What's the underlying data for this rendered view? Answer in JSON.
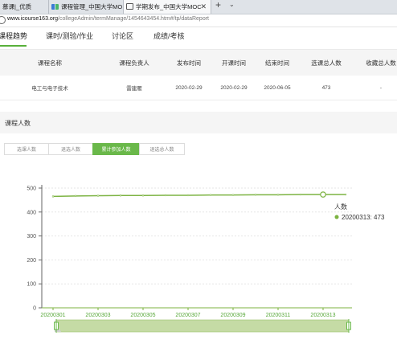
{
  "browser": {
    "tabs": [
      {
        "label": "慕课|_优质",
        "icon": "",
        "active": false
      },
      {
        "label": "课程管理_中国大学MOOC(",
        "icon": "bars-icon",
        "active": false
      },
      {
        "label": "学期发布_中国大学MOC",
        "icon": "page-icon",
        "active": true,
        "close": "✕"
      }
    ],
    "new_tab": "+",
    "tab_menu": "⌄",
    "url_host": "www.icourse163.org",
    "url_path": "/collegeAdmin/termManage/1454643454.htm#/tp/dataReport"
  },
  "course_nav": {
    "items": [
      "课程趋势",
      "课时/测验/作业",
      "讨论区",
      "成绩/考核"
    ],
    "active_index": 0,
    "accent": "#58b03a"
  },
  "info_table": {
    "headers": [
      "课程名称",
      "课程负责人",
      "发布时间",
      "开课时间",
      "结束时间",
      "选课总人数",
      "收藏总人数"
    ],
    "row": [
      "电工与电子技术",
      "雷建雁",
      "2020-02-29",
      "2020-02-29",
      "2020-06-05",
      "473",
      "-"
    ]
  },
  "section": {
    "title": "课程人数"
  },
  "segments": {
    "items": [
      "选课人数",
      "退选人数",
      "累计参加人数",
      "退选总人数"
    ],
    "active_index": 2,
    "active_color": "#6ab84a"
  },
  "tooltip": {
    "series": "人数",
    "text": "20200313: 473"
  },
  "chart_data": {
    "type": "line",
    "title": "",
    "xlabel": "",
    "ylabel": "",
    "ylim": [
      0,
      500
    ],
    "yticks": [
      0,
      100,
      200,
      300,
      400,
      500
    ],
    "x": [
      "20200301",
      "20200302",
      "20200303",
      "20200304",
      "20200305",
      "20200306",
      "20200307",
      "20200308",
      "20200309",
      "20200310",
      "20200311",
      "20200312",
      "20200313",
      "20200314"
    ],
    "xtick_labels": [
      "20200301",
      "20200303",
      "20200305",
      "20200307",
      "20200309",
      "20200311",
      "20200313"
    ],
    "series": [
      {
        "name": "人数",
        "values": [
          465,
          467,
          468,
          469,
          469,
          470,
          470,
          471,
          471,
          472,
          472,
          473,
          473,
          473
        ],
        "color": "#7cb342"
      }
    ],
    "highlight_x": "20200313",
    "grid": true,
    "legend": "none",
    "datazoom": {
      "start": 0,
      "end": 1
    }
  }
}
